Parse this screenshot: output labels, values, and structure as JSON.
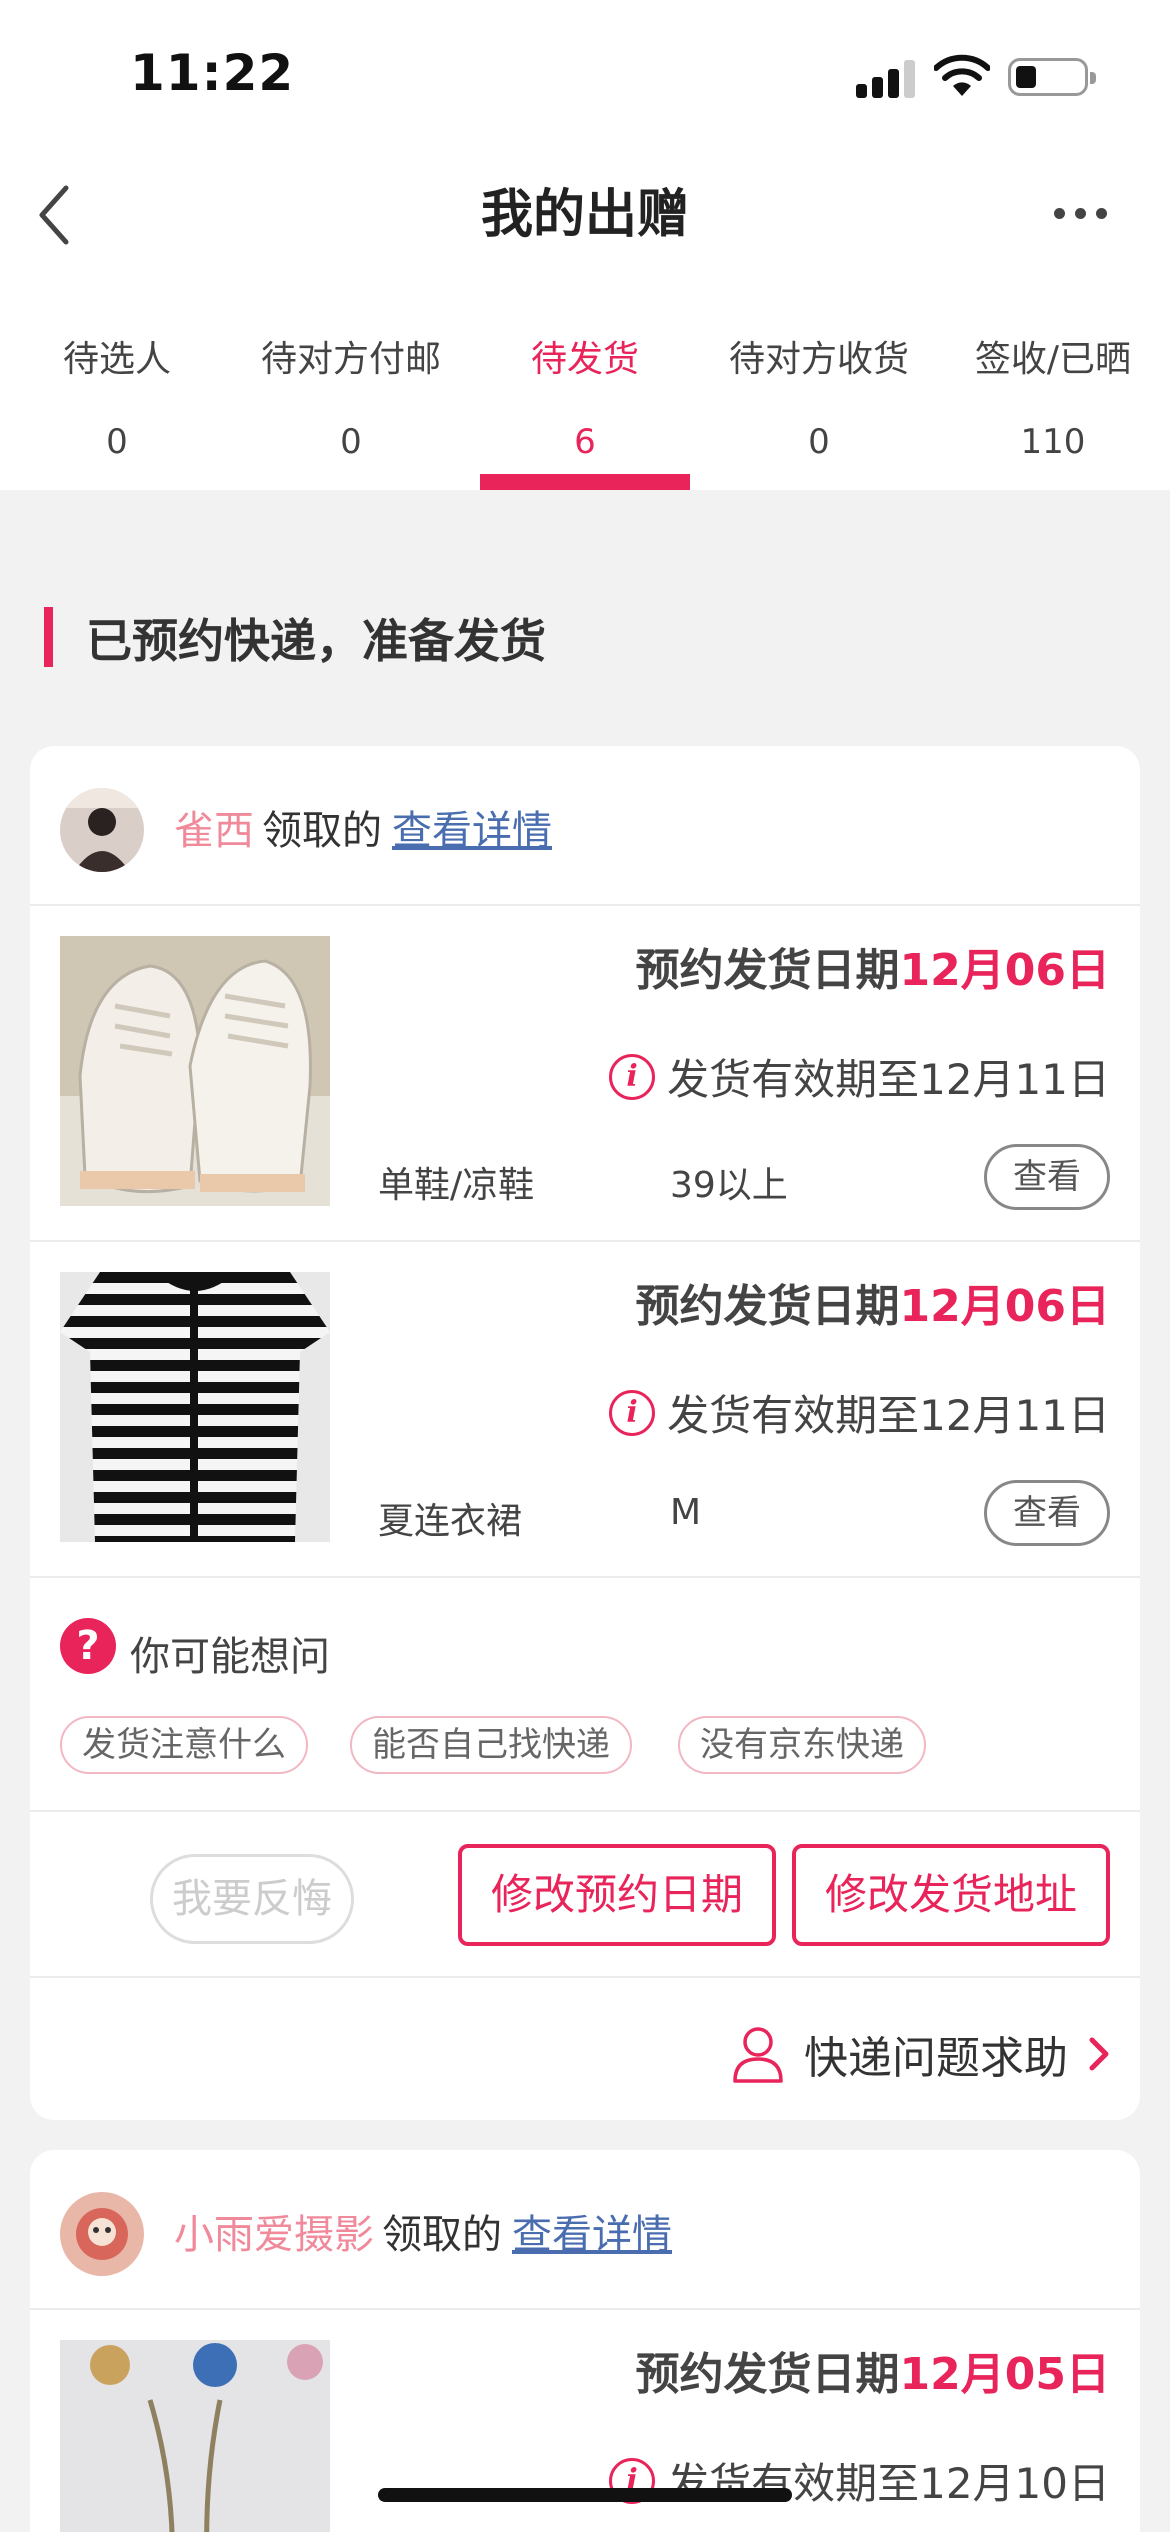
{
  "status_bar": {
    "time": "11:22"
  },
  "nav": {
    "title": "我的出赠"
  },
  "tabs": [
    {
      "label": "待选人",
      "count": "0"
    },
    {
      "label": "待对方付邮",
      "count": "0"
    },
    {
      "label": "待发货",
      "count": "6",
      "active": true
    },
    {
      "label": "待对方收货",
      "count": "0"
    },
    {
      "label": "签收/已晒",
      "count": "110"
    }
  ],
  "section": {
    "title": "已预约快递，准备发货"
  },
  "colors": {
    "accent": "#e8245a",
    "username": "#f08a9b",
    "link": "#4a6db0"
  },
  "cards": [
    {
      "user": "雀西",
      "received_text": "领取的",
      "detail_link": "查看详情",
      "items": [
        {
          "ship_label": "预约发货日期",
          "ship_date": "12月06日",
          "validity": "发货有效期至12月11日",
          "category": "单鞋/凉鞋",
          "size": "39以上",
          "view_label": "查看"
        },
        {
          "ship_label": "预约发货日期",
          "ship_date": "12月06日",
          "validity": "发货有效期至12月11日",
          "category": "夏连衣裙",
          "size": "M",
          "view_label": "查看"
        }
      ],
      "faq": {
        "title": "你可能想问",
        "chips": [
          "发货注意什么",
          "能否自己找快递",
          "没有京东快递"
        ]
      },
      "actions": {
        "regret": "我要反悔",
        "change_date": "修改预约日期",
        "change_address": "修改发货地址"
      },
      "help": "快递问题求助"
    },
    {
      "user": "小雨爱摄影",
      "received_text": "领取的",
      "detail_link": "查看详情",
      "items": [
        {
          "ship_label": "预约发货日期",
          "ship_date": "12月05日",
          "validity": "发货有效期至12月10日"
        }
      ]
    }
  ]
}
